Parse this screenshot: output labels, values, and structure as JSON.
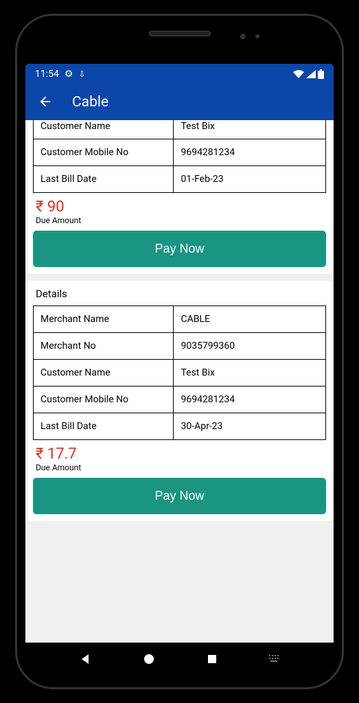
{
  "status": {
    "time": "11:54",
    "gear": "⚙",
    "down": "⇩"
  },
  "header": {
    "title": "Cable"
  },
  "labels": {
    "details": "Details",
    "customerName": "Customer Name",
    "customerMobile": "Customer Mobile No",
    "lastBillDate": "Last Bill Date",
    "merchantName": "Merchant Name",
    "merchantNo": "Merchant No",
    "dueAmount": "Due Amount",
    "payNow": "Pay Now"
  },
  "bill1": {
    "customerName": "Test  Bix",
    "customerMobile": "9694281234",
    "lastBillDate": "01-Feb-23",
    "amount": "₹ 90"
  },
  "bill2": {
    "merchantName": "CABLE",
    "merchantNo": "9035799360",
    "customerName": "Test Bix",
    "customerMobile": "9694281234",
    "lastBillDate": "30-Apr-23",
    "amount": "₹ 17.7"
  }
}
